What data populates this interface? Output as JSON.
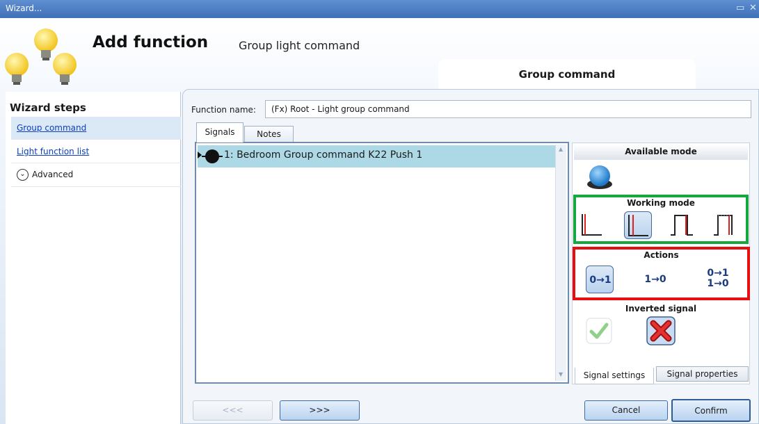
{
  "window": {
    "title": "Wizard..."
  },
  "header": {
    "title": "Add function",
    "subtitle": "Group light command",
    "active_step_tab": "Group command"
  },
  "wizard_steps": {
    "title": "Wizard steps",
    "items": [
      {
        "label": "Group command"
      },
      {
        "label": "Light function list"
      },
      {
        "label": "Advanced"
      }
    ]
  },
  "function_name": {
    "label": "Function name:",
    "value": "(Fx) Root - Light group command"
  },
  "tabs": {
    "signals": "Signals",
    "notes": "Notes"
  },
  "signals": [
    {
      "label": "1: Bedroom Group command K22 Push 1"
    }
  ],
  "settings": {
    "available_mode_title": "Available mode",
    "working_mode_title": "Working mode",
    "actions_title": "Actions",
    "actions": [
      "0→1",
      "1→0",
      "0→1",
      "1→0"
    ],
    "inverted_signal_title": "Inverted signal",
    "tab_signal_settings": "Signal settings",
    "tab_signal_properties": "Signal properties"
  },
  "buttons": {
    "prev": "<<<",
    "next": ">>>",
    "cancel": "Cancel",
    "confirm": "Confirm"
  },
  "colors": {
    "working_mode_border": "#15a83f",
    "actions_border": "#e60e0e",
    "title_bar": "#4f80c4"
  }
}
